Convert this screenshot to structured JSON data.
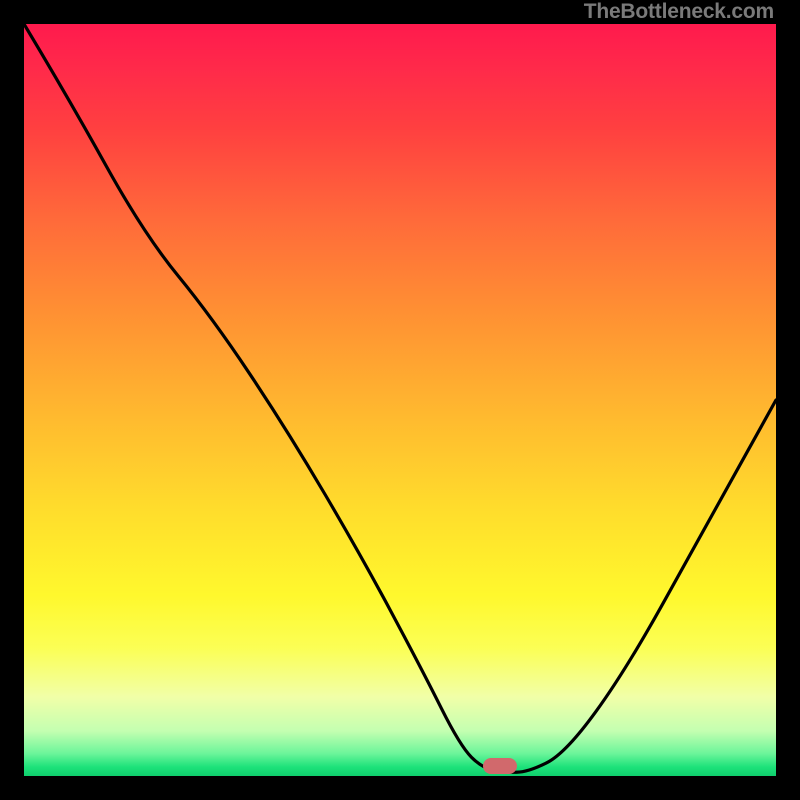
{
  "watermark": "TheBottleneck.com",
  "colors": {
    "frame": "#000000",
    "curve": "#000000",
    "marker": "#d1696c"
  },
  "marker": {
    "x_frac": 0.633,
    "y_frac": 0.987,
    "w": 34,
    "h": 16
  },
  "chart_data": {
    "type": "line",
    "title": "",
    "xlabel": "",
    "ylabel": "",
    "xlim": [
      0,
      100
    ],
    "ylim": [
      0,
      100
    ],
    "series": [
      {
        "name": "bottleneck-curve",
        "x": [
          0,
          6,
          16,
          25,
          35,
          45,
          53,
          58,
          61,
          64,
          67,
          72,
          80,
          90,
          100
        ],
        "values": [
          100,
          90,
          72,
          61,
          46,
          29,
          14,
          4,
          1,
          0.5,
          0.5,
          3,
          14,
          32,
          50
        ]
      }
    ],
    "annotations": [
      {
        "type": "optimum-marker",
        "x": 64,
        "y": 0.5
      }
    ],
    "background": {
      "type": "vertical-gradient",
      "meaning": "red=high bottleneck, green=low bottleneck",
      "stops": [
        {
          "pos": 0.0,
          "color": "#ff1a4d"
        },
        {
          "pos": 0.5,
          "color": "#ffb92f"
        },
        {
          "pos": 0.8,
          "color": "#fff82d"
        },
        {
          "pos": 1.0,
          "color": "#0fcf6d"
        }
      ]
    }
  }
}
